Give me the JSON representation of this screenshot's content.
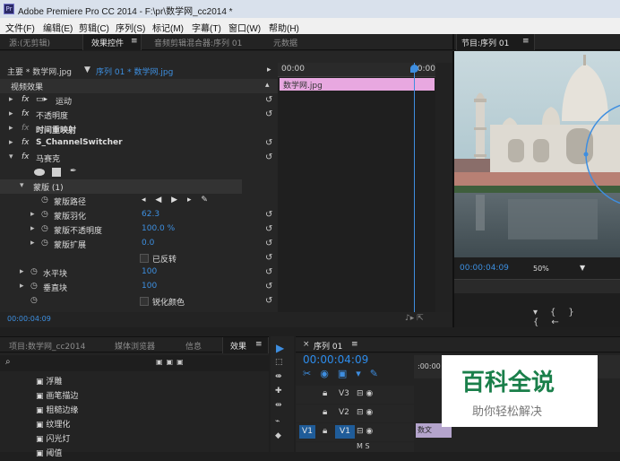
{
  "window": {
    "title": "Adobe Premiere Pro CC 2014 - F:\\pr\\数学网_cc2014 *"
  },
  "menu": [
    "文件(F)",
    "编辑(E)",
    "剪辑(C)",
    "序列(S)",
    "标记(M)",
    "字幕(T)",
    "窗口(W)",
    "帮助(H)"
  ],
  "top_tabs": {
    "source": "源:(无剪辑)",
    "effect_controls": "效果控件",
    "audio_mixer": "音频剪辑混合器:序列 01",
    "metadata": "元数据",
    "menu_glyph": "≡"
  },
  "effect_controls": {
    "master_clip": "主要 * 数学网.jpg",
    "sequence_clip": "序列 01 * 数学网.jpg",
    "timecode_start": "00:00",
    "timecode_end": "00:00",
    "clip_bar_label": "数学网.jpg",
    "section": "视频效果",
    "effects": [
      "运动",
      "不透明度",
      "时间重映射",
      "S_ChannelSwitcher",
      "马赛克"
    ],
    "mask_label": "蒙版 (1)",
    "mask_path": "蒙版路径",
    "mask_feather": "蒙版羽化",
    "mask_feather_val": "62.3",
    "mask_opacity": "蒙版不透明度",
    "mask_opacity_val": "100.0 %",
    "mask_expand": "蒙版扩展",
    "mask_expand_val": "0.0",
    "inverted": "已反转",
    "h_blocks": "水平块",
    "h_blocks_val": "100",
    "v_blocks": "垂直块",
    "v_blocks_val": "100",
    "sharpen": "锐化颜色",
    "bottom_time": "00:00:04:09"
  },
  "program": {
    "tab": "节目:序列 01",
    "timecode": "00:00:04:09",
    "zoom": "50%"
  },
  "project_panel": {
    "tabs": [
      "项目:数学网_cc2014",
      "媒体浏览器",
      "信息",
      "效果"
    ],
    "items": [
      "浮雕",
      "画笔描边",
      "粗糙边缘",
      "纹理化",
      "闪光灯",
      "阈值"
    ]
  },
  "timeline": {
    "tab": "序列 01",
    "timecode": "00:00:04:09",
    "ruler_start": ":00:00",
    "tracks": [
      "V3",
      "V2",
      "V1"
    ],
    "clip_label": "数文",
    "track_misc": "M S"
  },
  "watermark": {
    "title": "百科全说",
    "subtitle": "助你轻松解决"
  },
  "colors": {
    "accent_blue": "#2d8ceb",
    "clip_pink": "#e8a8e0",
    "playhead": "#3e8ee0"
  }
}
